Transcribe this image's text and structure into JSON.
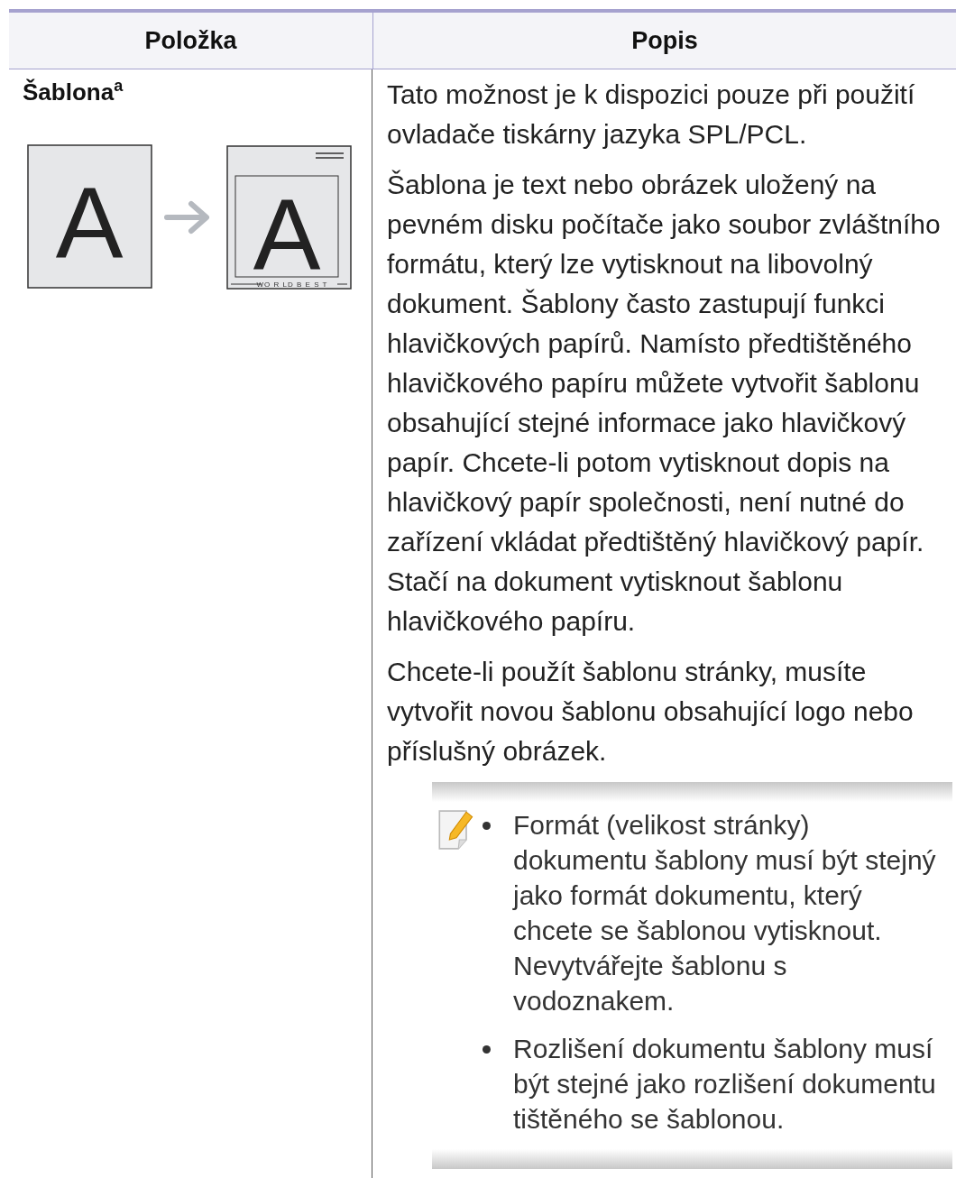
{
  "table": {
    "columns": [
      "Položka",
      "Popis"
    ],
    "rows": [
      {
        "item": "Šablona$^{a}$",
        "illustration": {
          "before_letter": "A",
          "after_letter": "A",
          "footer_text": "WO R LD B E S T"
        },
        "paragraphs": [
          "Tato možnost je k dispozici pouze při použití ovladače tiskárny jazyka SPL/PCL.",
          "Šablona je text nebo obrázek uložený na pevném disku počítače jako soubor zvláštního formátu, který lze vytisknout na libovolný dokument. Šablony často zastupují funkci hlavičkových papírů. Namísto předtištěného hlavičkového papíru můžete vytvořit šablonu obsahující stejné informace jako hlavičkový papír. Chcete-li potom vytisknout dopis na hlavičkový papír společnosti, není nutné do zařízení vkládat předtištěný hlavičkový papír. Stačí na dokument vytisknout šablonu hlavičkového papíru.",
          "Chcete-li použít šablonu stránky, musíte vytvořit novou šablonu obsahující logo nebo příslušný obrázek."
        ],
        "note": {
          "bullets": [
            "Formát (velikost stránky) dokumentu šablony musí být stejný jako formát dokumentu, který chcete se šablonou vytisknout. Nevytvářejte šablonu s vodoznakem.",
            "Rozlišení dokumentu šablony musí být stejné jako rozlišení dokumentu tištěného se šablonou."
          ]
        }
      }
    ]
  }
}
